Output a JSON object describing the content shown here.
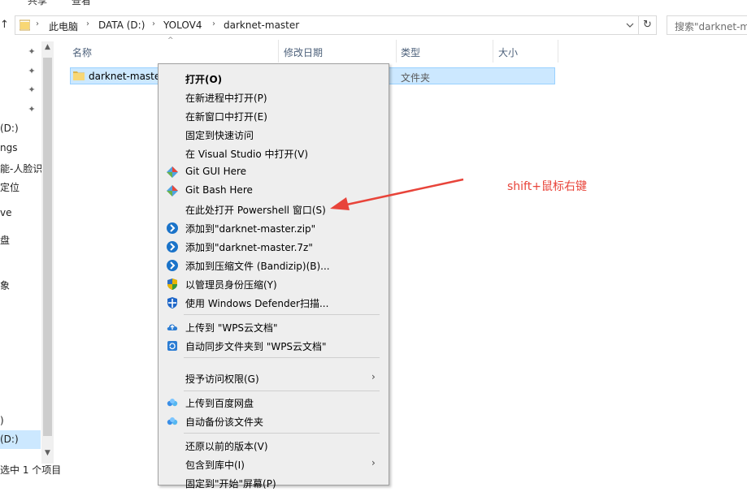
{
  "ribbon": {
    "share_label": "共享",
    "view_label": "查看"
  },
  "address": {
    "crumbs": [
      "此电脑",
      "DATA (D:)",
      "YOLOV4",
      "darknet-master"
    ],
    "search_placeholder": "搜索\"darknet-m"
  },
  "nav": {
    "items": [
      "(D:)",
      "ngs",
      "能-人脸识",
      "定位",
      "ve",
      "盘",
      "象",
      ")",
      "(D:)"
    ]
  },
  "status": {
    "text": "选中 1 个项目"
  },
  "columns": {
    "name": "名称",
    "modified": "修改日期",
    "type": "类型",
    "size": "大小"
  },
  "row": {
    "name": "darknet-master",
    "type": "文件夹"
  },
  "menu": {
    "items": [
      {
        "label": "打开(O)",
        "icon": "none"
      },
      {
        "label": "在新进程中打开(P)",
        "icon": "none"
      },
      {
        "label": "在新窗口中打开(E)",
        "icon": "none"
      },
      {
        "label": "固定到快速访问",
        "icon": "none"
      },
      {
        "label": "在 Visual Studio 中打开(V)",
        "icon": "none"
      },
      {
        "label": "Git GUI Here",
        "icon": "git-gui-icon"
      },
      {
        "label": "Git Bash Here",
        "icon": "git-bash-icon"
      },
      {
        "label": "在此处打开 Powershell 窗口(S)",
        "icon": "none"
      },
      {
        "label": "添加到\"darknet-master.zip\"",
        "icon": "bandizip-icon"
      },
      {
        "label": "添加到\"darknet-master.7z\"",
        "icon": "bandizip-icon"
      },
      {
        "label": "添加到压缩文件 (Bandizip)(B)...",
        "icon": "bandizip-icon"
      },
      {
        "label": "以管理员身份压缩(Y)",
        "icon": "admin-shield-icon"
      },
      {
        "label": "使用 Windows Defender扫描...",
        "icon": "defender-icon"
      },
      {
        "label": "上传到 \"WPS云文档\"",
        "icon": "wps-cloud-upload-icon"
      },
      {
        "label": "自动同步文件夹到 \"WPS云文档\"",
        "icon": "wps-sync-icon"
      },
      {
        "label": "授予访问权限(G)",
        "icon": "none"
      },
      {
        "label": "上传到百度网盘",
        "icon": "baidu-netdisk-icon"
      },
      {
        "label": "自动备份该文件夹",
        "icon": "baidu-netdisk-icon"
      },
      {
        "label": "还原以前的版本(V)",
        "icon": "none"
      },
      {
        "label": "包含到库中(I)",
        "icon": "none"
      },
      {
        "label": "固定到\"开始\"屏幕(P)",
        "icon": "none"
      }
    ]
  },
  "annotation": {
    "text": "shift+鼠标右键",
    "color": "#e8443a"
  },
  "colors": {
    "selection": "#cce8ff",
    "selection_border": "#99d1ff",
    "menu_bg": "#eeeeee"
  }
}
